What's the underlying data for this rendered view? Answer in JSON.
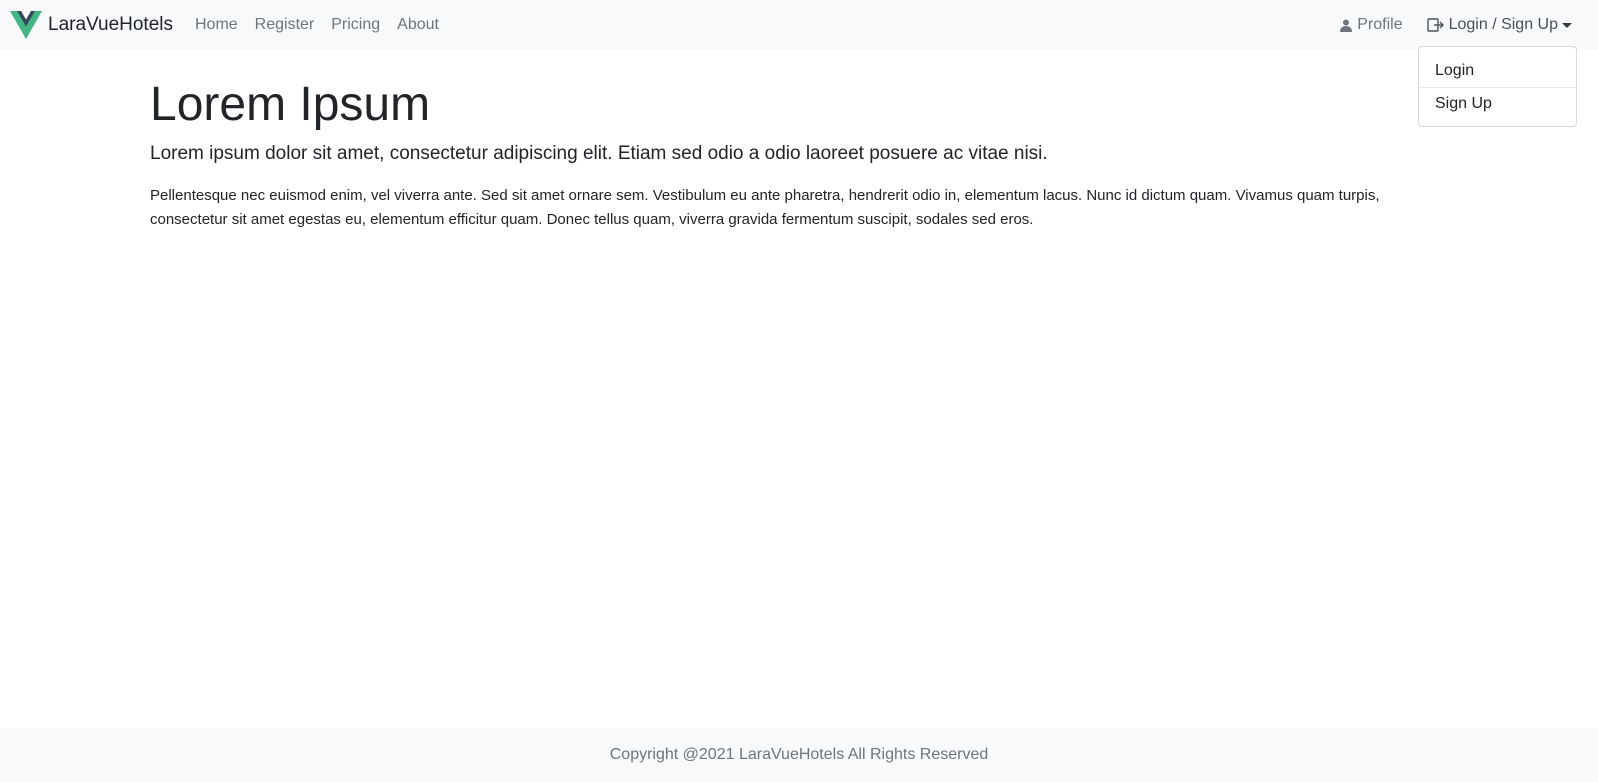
{
  "navbar": {
    "brand": "LaraVueHotels",
    "links": [
      "Home",
      "Register",
      "Pricing",
      "About"
    ],
    "profile_label": "Profile",
    "auth_label": "Login / Sign Up",
    "brand_colors": {
      "outer": "#41b883",
      "inner": "#35495e"
    }
  },
  "dropdown": {
    "items": [
      "Login",
      "Sign Up"
    ]
  },
  "main": {
    "title": "Lorem Ipsum",
    "lead": "Lorem ipsum dolor sit amet, consectetur adipiscing elit. Etiam sed odio a odio laoreet posuere ac vitae nisi.",
    "body": "Pellentesque nec euismod enim, vel viverra ante. Sed sit amet ornare sem. Vestibulum eu ante pharetra, hendrerit odio in, elementum lacus. Nunc id dictum quam. Vivamus quam turpis, consectetur sit amet egestas eu, elementum efficitur quam. Donec tellus quam, viverra gravida fermentum suscipit, sodales sed eros."
  },
  "footer": {
    "text": "Copyright @2021 LaraVueHotels All Rights Reserved"
  }
}
